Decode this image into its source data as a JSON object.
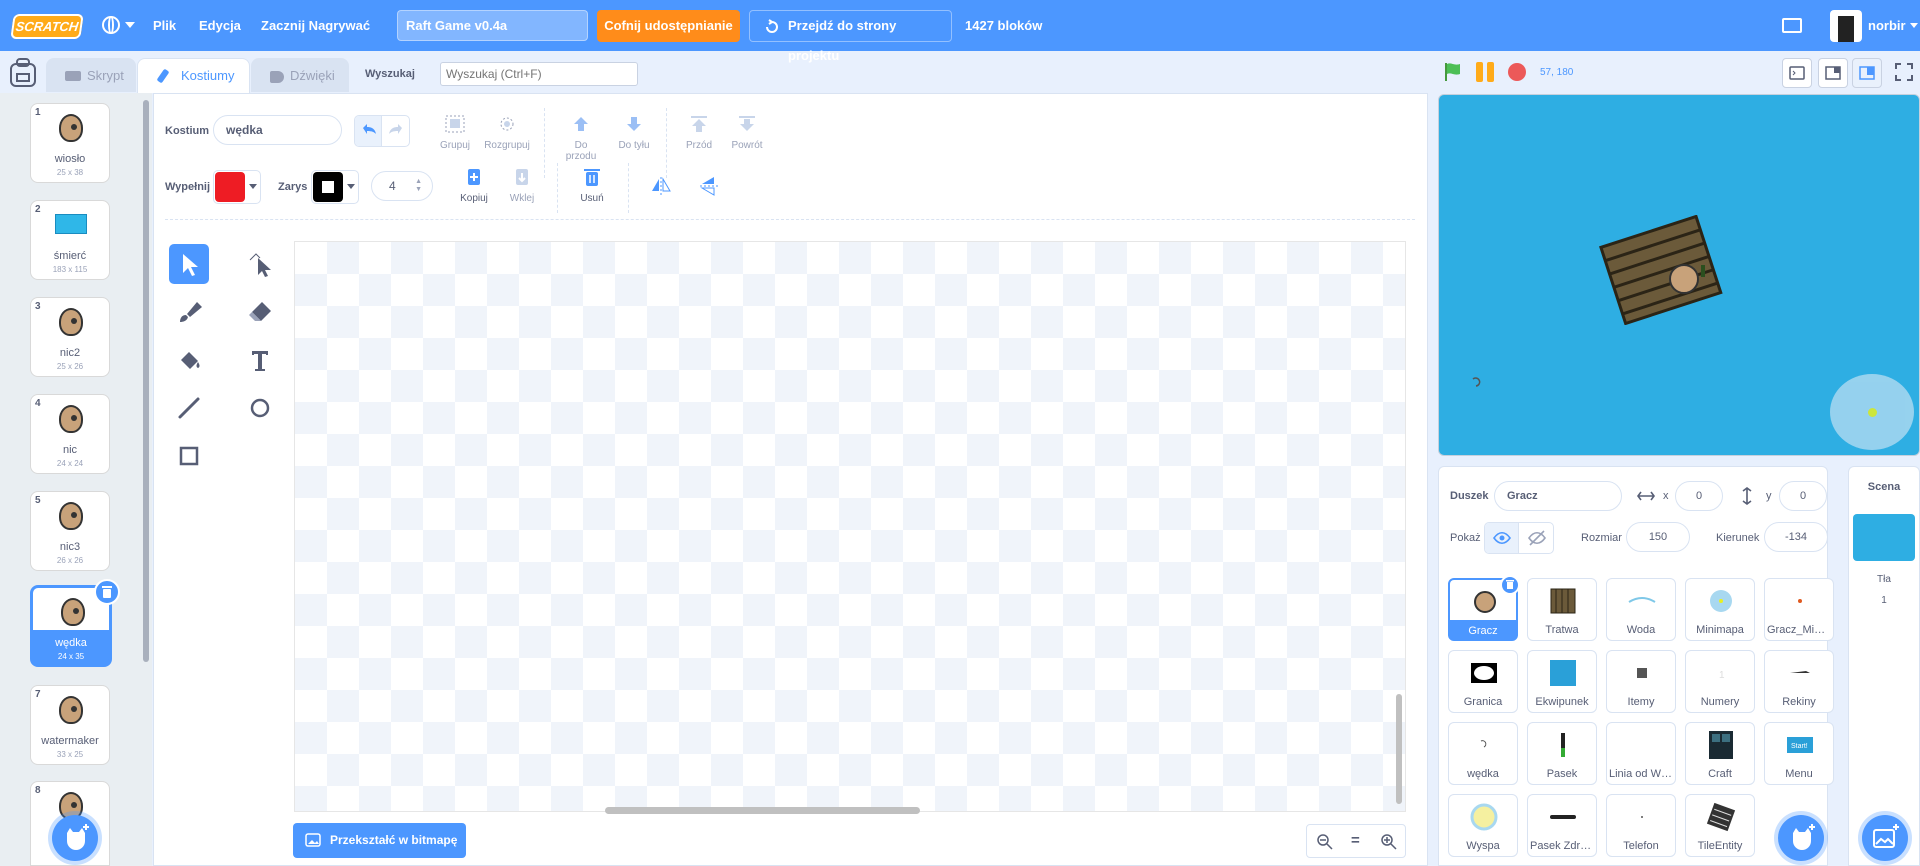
{
  "menubar": {
    "logo": "SCRATCH",
    "file": "Plik",
    "edit": "Edycja",
    "record": "Zacznij Nagrywać",
    "project_title": "Raft Game v0.4a",
    "unshare": "Cofnij udostępnianie",
    "goto_project": "Przejdź do strony projektu",
    "block_count": "1427 bloków",
    "username": "norbir"
  },
  "tabs": {
    "code": "Skrypt",
    "costumes": "Kostiumy",
    "sounds": "Dźwięki"
  },
  "search": {
    "label": "Wyszukaj",
    "placeholder": "Wyszukaj (Ctrl+F)"
  },
  "stage_header": {
    "coords": "57, 180"
  },
  "costumes": [
    {
      "num": "1",
      "name": "wiosło",
      "size": "25 x 38"
    },
    {
      "num": "2",
      "name": "śmierć",
      "size": "183 x 115"
    },
    {
      "num": "3",
      "name": "nic2",
      "size": "25 x 26"
    },
    {
      "num": "4",
      "name": "nic",
      "size": "24 x 24"
    },
    {
      "num": "5",
      "name": "nic3",
      "size": "26 x 26"
    },
    {
      "num": "6",
      "name": "wędka",
      "size": "24 x 35"
    },
    {
      "num": "7",
      "name": "watermaker",
      "size": "33 x 25"
    },
    {
      "num": "8",
      "name": "",
      "size": ""
    }
  ],
  "paint": {
    "costume_label": "Kostium",
    "costume_name": "wędka",
    "group": "Grupuj",
    "ungroup": "Rozgrupuj",
    "forward": "Do przodu",
    "backward": "Do tyłu",
    "front": "Przód",
    "back": "Powrót",
    "fill_label": "Wypełnij",
    "outline_label": "Zarys",
    "outline_width": "4",
    "copy": "Kopiuj",
    "paste": "Wklej",
    "delete": "Usuń",
    "convert": "Przekształć w bitmapę",
    "zoom_reset": "=",
    "fill_color": "#ee1c24",
    "outline_color": "#000000"
  },
  "sprite_info": {
    "sprite_label": "Duszek",
    "sprite_name": "Gracz",
    "x_label": "x",
    "x": "0",
    "y_label": "y",
    "y": "0",
    "show_label": "Pokaż",
    "size_label": "Rozmiar",
    "size": "150",
    "direction_label": "Kierunek",
    "direction": "-134"
  },
  "sprites": [
    "Gracz",
    "Tratwa",
    "Woda",
    "Minimapa",
    "Gracz_Minimapa",
    "Granica",
    "Ekwipunek",
    "Itemy",
    "Numery",
    "Rekiny",
    "wędka",
    "Pasek",
    "Linia od Wędki",
    "Craft",
    "Menu",
    "Wyspa",
    "Pasek Zdrowia",
    "Telefon",
    "TileEntity"
  ],
  "scene": {
    "title": "Scena",
    "backdrops_label": "Tła",
    "backdrops_count": "1"
  },
  "colors": {
    "accent": "#4c97ff",
    "menubar": "#4c97ff",
    "orange": "#ff8c1a",
    "stage": "#2eaee3"
  }
}
